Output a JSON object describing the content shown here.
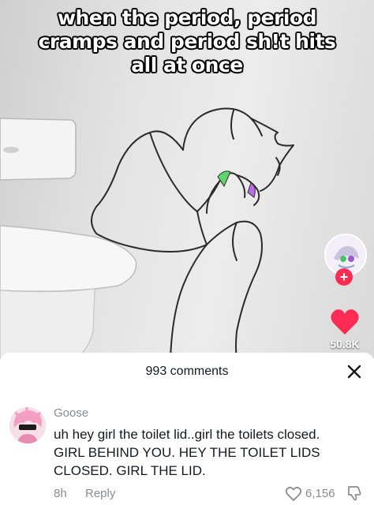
{
  "video": {
    "caption": "when the period, period cramps and period sh!t hits all at once",
    "like_count": "50.8K",
    "follow_symbol": "+"
  },
  "comments_panel": {
    "title": "993 comments",
    "comment": {
      "username": "Goose",
      "text": "uh hey girl the toilet lid..girl the toilets closed. GIRL BEHIND YOU. HEY THE TOILET LIDS CLOSED. GIRL THE LID.",
      "time": "8h",
      "reply_label": "Reply",
      "like_count": "6,156"
    }
  },
  "colors": {
    "like_red": "#fe2c55",
    "secondary_text": "#8a8b91",
    "primary_text": "#161823"
  },
  "icons": [
    "heart-icon",
    "close-icon",
    "heart-outline-icon",
    "dislike-icon",
    "plus-icon"
  ]
}
